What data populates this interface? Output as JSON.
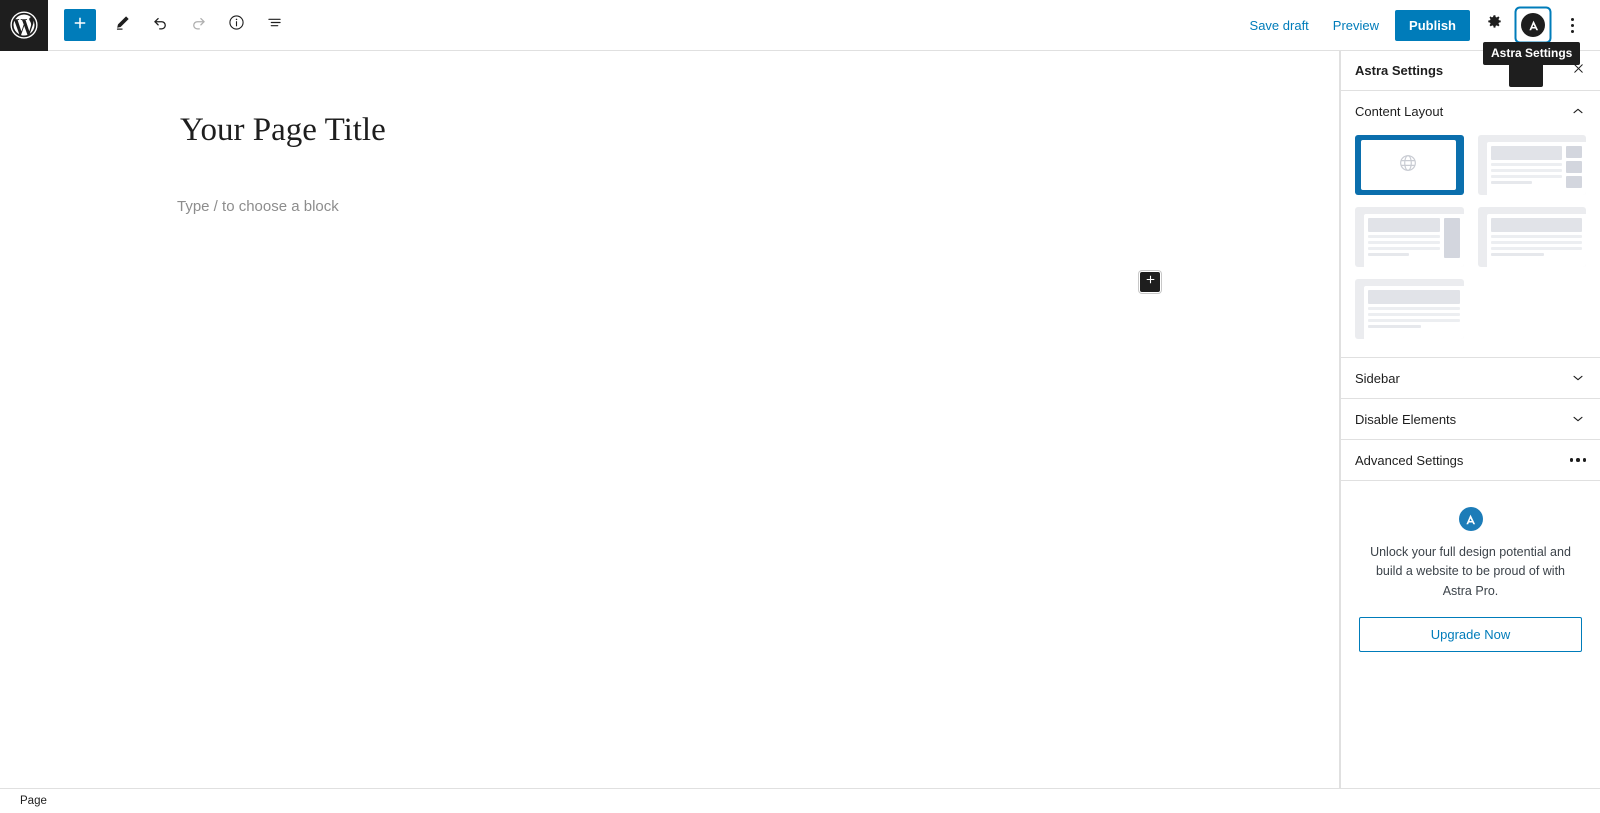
{
  "topbar": {
    "wp_logo_icon": "wordpress-logo-icon",
    "tools": [
      {
        "name": "add-block-button",
        "icon": "plus-icon",
        "label": "Add block",
        "state": "primary"
      },
      {
        "name": "edit-tool-button",
        "icon": "pencil-icon",
        "label": "Tools",
        "state": "normal"
      },
      {
        "name": "undo-button",
        "icon": "undo-arrow-icon",
        "label": "Undo",
        "state": "normal"
      },
      {
        "name": "redo-button",
        "icon": "redo-arrow-icon",
        "label": "Redo",
        "state": "disabled"
      },
      {
        "name": "details-button",
        "icon": "info-circle-icon",
        "label": "Details",
        "state": "normal"
      },
      {
        "name": "list-view-button",
        "icon": "list-view-icon",
        "label": "List View",
        "state": "normal"
      }
    ],
    "save_draft_label": "Save draft",
    "preview_label": "Preview",
    "publish_label": "Publish",
    "settings_icon": "gear-icon",
    "astra_icon": "astra-logo-icon",
    "options_icon": "kebab-menu-icon",
    "tooltip_text": "Astra Settings"
  },
  "editor": {
    "title": "Your Page Title",
    "paragraph_placeholder": "Type / to choose a block",
    "inserter_icon": "plus-icon"
  },
  "sidebar": {
    "title": "Astra Settings",
    "pin_icon": "star-icon",
    "close_icon": "close-x-icon",
    "panels": [
      {
        "label": "Content Layout",
        "state": "expanded",
        "control": "chevron-up-icon"
      },
      {
        "label": "Sidebar",
        "state": "collapsed",
        "control": "chevron-down-icon"
      },
      {
        "label": "Disable Elements",
        "state": "collapsed",
        "control": "chevron-down-icon"
      },
      {
        "label": "Advanced Settings",
        "state": "collapsed",
        "control": "ellipsis-icon"
      }
    ],
    "content_layout": {
      "options": [
        {
          "name": "default-layout",
          "variant": "globe",
          "selected": true
        },
        {
          "name": "content-with-right-sidebar-boxed",
          "variant": "right-blocks",
          "selected": false
        },
        {
          "name": "narrow-width-with-sidebar",
          "variant": "right-sidebar",
          "selected": false
        },
        {
          "name": "full-width-contained",
          "variant": "plain-offset",
          "selected": false
        },
        {
          "name": "full-width-stretched",
          "variant": "plain-wide",
          "selected": false
        }
      ]
    },
    "promo": {
      "logo_icon": "astra-logo-icon",
      "text": "Unlock your full design potential and build a website to be proud of with Astra Pro.",
      "button_label": "Upgrade Now"
    }
  },
  "footer": {
    "document_type": "Page"
  },
  "colors": {
    "accent": "#007cba",
    "selected_layout": "#0b6fad",
    "dark": "#1e1e1e",
    "astra_blue": "#1c7cb8"
  }
}
